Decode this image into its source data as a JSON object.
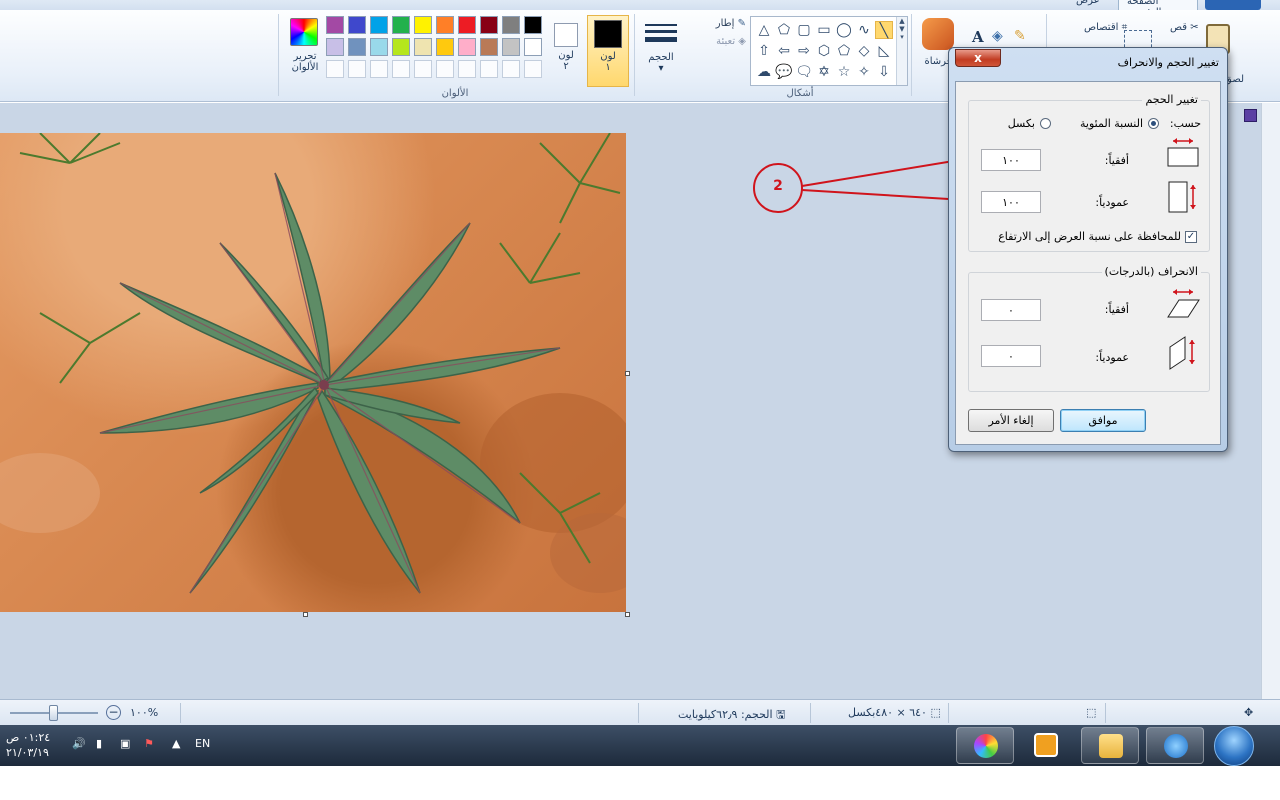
{
  "ribbon": {
    "tabs": {
      "file": "",
      "home": "الصفحة الرئيسية",
      "view": "عرض"
    },
    "edit_colors_label": "تحرير الألوان",
    "colors_group_title": "الألوان",
    "color2_label": "لون ٢",
    "color1_label": "لون ١",
    "size_label": "الحجم",
    "outline_label": "إطار",
    "fill_label": "تعبئة",
    "shapes_group_title": "أشكال",
    "brushes_label": "فرشاة",
    "crop_label": "اقتصاص",
    "cut_label": "قص",
    "paste_label": "لصق",
    "palette_row1": [
      "#000000",
      "#7f7f7f",
      "#880015",
      "#ed1c24",
      "#ff7f27",
      "#fff200",
      "#22b14c",
      "#00a2e8",
      "#3f48cc",
      "#a349a4"
    ],
    "palette_row2": [
      "#ffffff",
      "#c3c3c3",
      "#b97a57",
      "#ffaec9",
      "#ffc90e",
      "#efe4b0",
      "#b5e61d",
      "#99d9ea",
      "#7092be",
      "#c8bfe7"
    ],
    "shape_icons": [
      "line",
      "curve",
      "oval",
      "rectangle",
      "rounded-rectangle",
      "polygon",
      "triangle",
      "right-triangle",
      "diamond",
      "pentagon",
      "hexagon",
      "right-arrow",
      "left-arrow",
      "up-arrow",
      "down-arrow",
      "four-point-star",
      "five-point-star",
      "six-point-star",
      "rounded-callout",
      "oval-callout",
      "cloud-callout"
    ]
  },
  "status": {
    "canvas_size": "٦٤٠ × ٤٨٠بكسل",
    "file_size": "الحجم: ٦٢٫٩كيلوبايت",
    "zoom": "١٠٠%"
  },
  "annotation": {
    "label": "2",
    "color": "#d0141c"
  },
  "dialog": {
    "title": "تغيير الحجم والانحراف",
    "close": "x",
    "resize": {
      "legend": "تغيير الحجم",
      "by_label": "حسب:",
      "percentage_label": "النسبة المئوية",
      "pixels_label": "بكسل",
      "selected": "percentage",
      "horizontal_label": "أفقياً:",
      "horizontal_value": "١٠٠",
      "vertical_label": "عمودياً:",
      "vertical_value": "١٠٠",
      "maintain_aspect_label": "للمحافظة على نسبة العرض إلى الارتفاع",
      "maintain_aspect_checked": true
    },
    "skew": {
      "legend": "الانحراف (بالدرجات)",
      "horizontal_label": "أفقياً:",
      "horizontal_value": "٠",
      "vertical_label": "عمودياً:",
      "vertical_value": "٠"
    },
    "ok": "موافق",
    "cancel": "إلغاء الأمر"
  },
  "taskbar": {
    "language": "EN",
    "time": "٠١:٢٤ ص",
    "date": "٢١/٠٣/١٩"
  }
}
